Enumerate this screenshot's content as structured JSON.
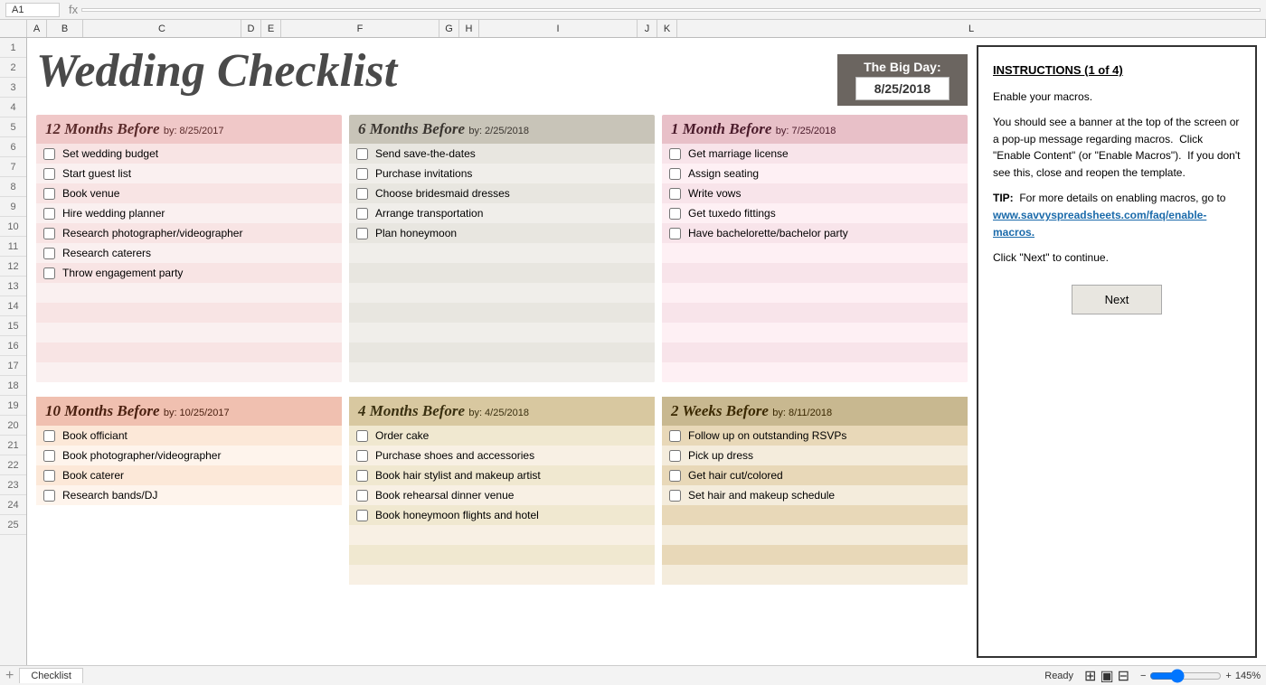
{
  "title": "Wedding Checklist",
  "bigDay": {
    "label": "The Big Day:",
    "date": "8/25/2018"
  },
  "tabs": [
    {
      "name": "Checklist",
      "active": true
    }
  ],
  "statusBar": {
    "readyText": "Ready",
    "zoom": "145%"
  },
  "instructions": {
    "title": "INSTRUCTIONS",
    "subtitle": "(1 of 4)",
    "steps": [
      "Enable your macros.",
      "You should see a banner at the top of the screen or a pop-up message regarding macros.  Click \"Enable Content\" (or \"Enable Macros\").  If you don't see this, close and reopen the template.",
      "TIP:  For more details on enabling macros, go to www.savvyspreadsheets.com/faq/enable-macros.",
      "Click \"Next\" to continue."
    ],
    "nextButton": "Next",
    "tipLabel": "TIP:",
    "tipLink": "www.savvyspreadsheets.com/faq/enable-macros."
  },
  "sections": {
    "twelveMonths": {
      "title": "12 Months Before",
      "byDate": "by: 8/25/2017",
      "items": [
        "Set wedding budget",
        "Start guest list",
        "Book venue",
        "Hire wedding planner",
        "Research photographer/videographer",
        "Research caterers",
        "Throw engagement party"
      ]
    },
    "sixMonths": {
      "title": "6 Months Before",
      "byDate": "by: 2/25/2018",
      "items": [
        "Send save-the-dates",
        "Purchase invitations",
        "Choose bridesmaid dresses",
        "Arrange transportation",
        "Plan honeymoon"
      ]
    },
    "oneMonth": {
      "title": "1 Month Before",
      "byDate": "by: 7/25/2018",
      "items": [
        "Get marriage license",
        "Assign seating",
        "Write vows",
        "Get tuxedo fittings",
        "Have bachelorette/bachelor party"
      ]
    },
    "tenMonths": {
      "title": "10 Months Before",
      "byDate": "by: 10/25/2017",
      "items": [
        "Book officiant",
        "Book photographer/videographer",
        "Book caterer",
        "Research bands/DJ"
      ]
    },
    "fourMonths": {
      "title": "4 Months Before",
      "byDate": "by: 4/25/2018",
      "items": [
        "Order cake",
        "Purchase shoes and accessories",
        "Book hair stylist and makeup artist",
        "Book rehearsal dinner venue",
        "Book honeymoon flights and hotel"
      ]
    },
    "twoWeeks": {
      "title": "2 Weeks Before",
      "byDate": "by: 8/11/2018",
      "items": [
        "Follow up on outstanding RSVPs",
        "Pick up dress",
        "Get hair cut/colored",
        "Set hair and makeup schedule"
      ]
    }
  }
}
